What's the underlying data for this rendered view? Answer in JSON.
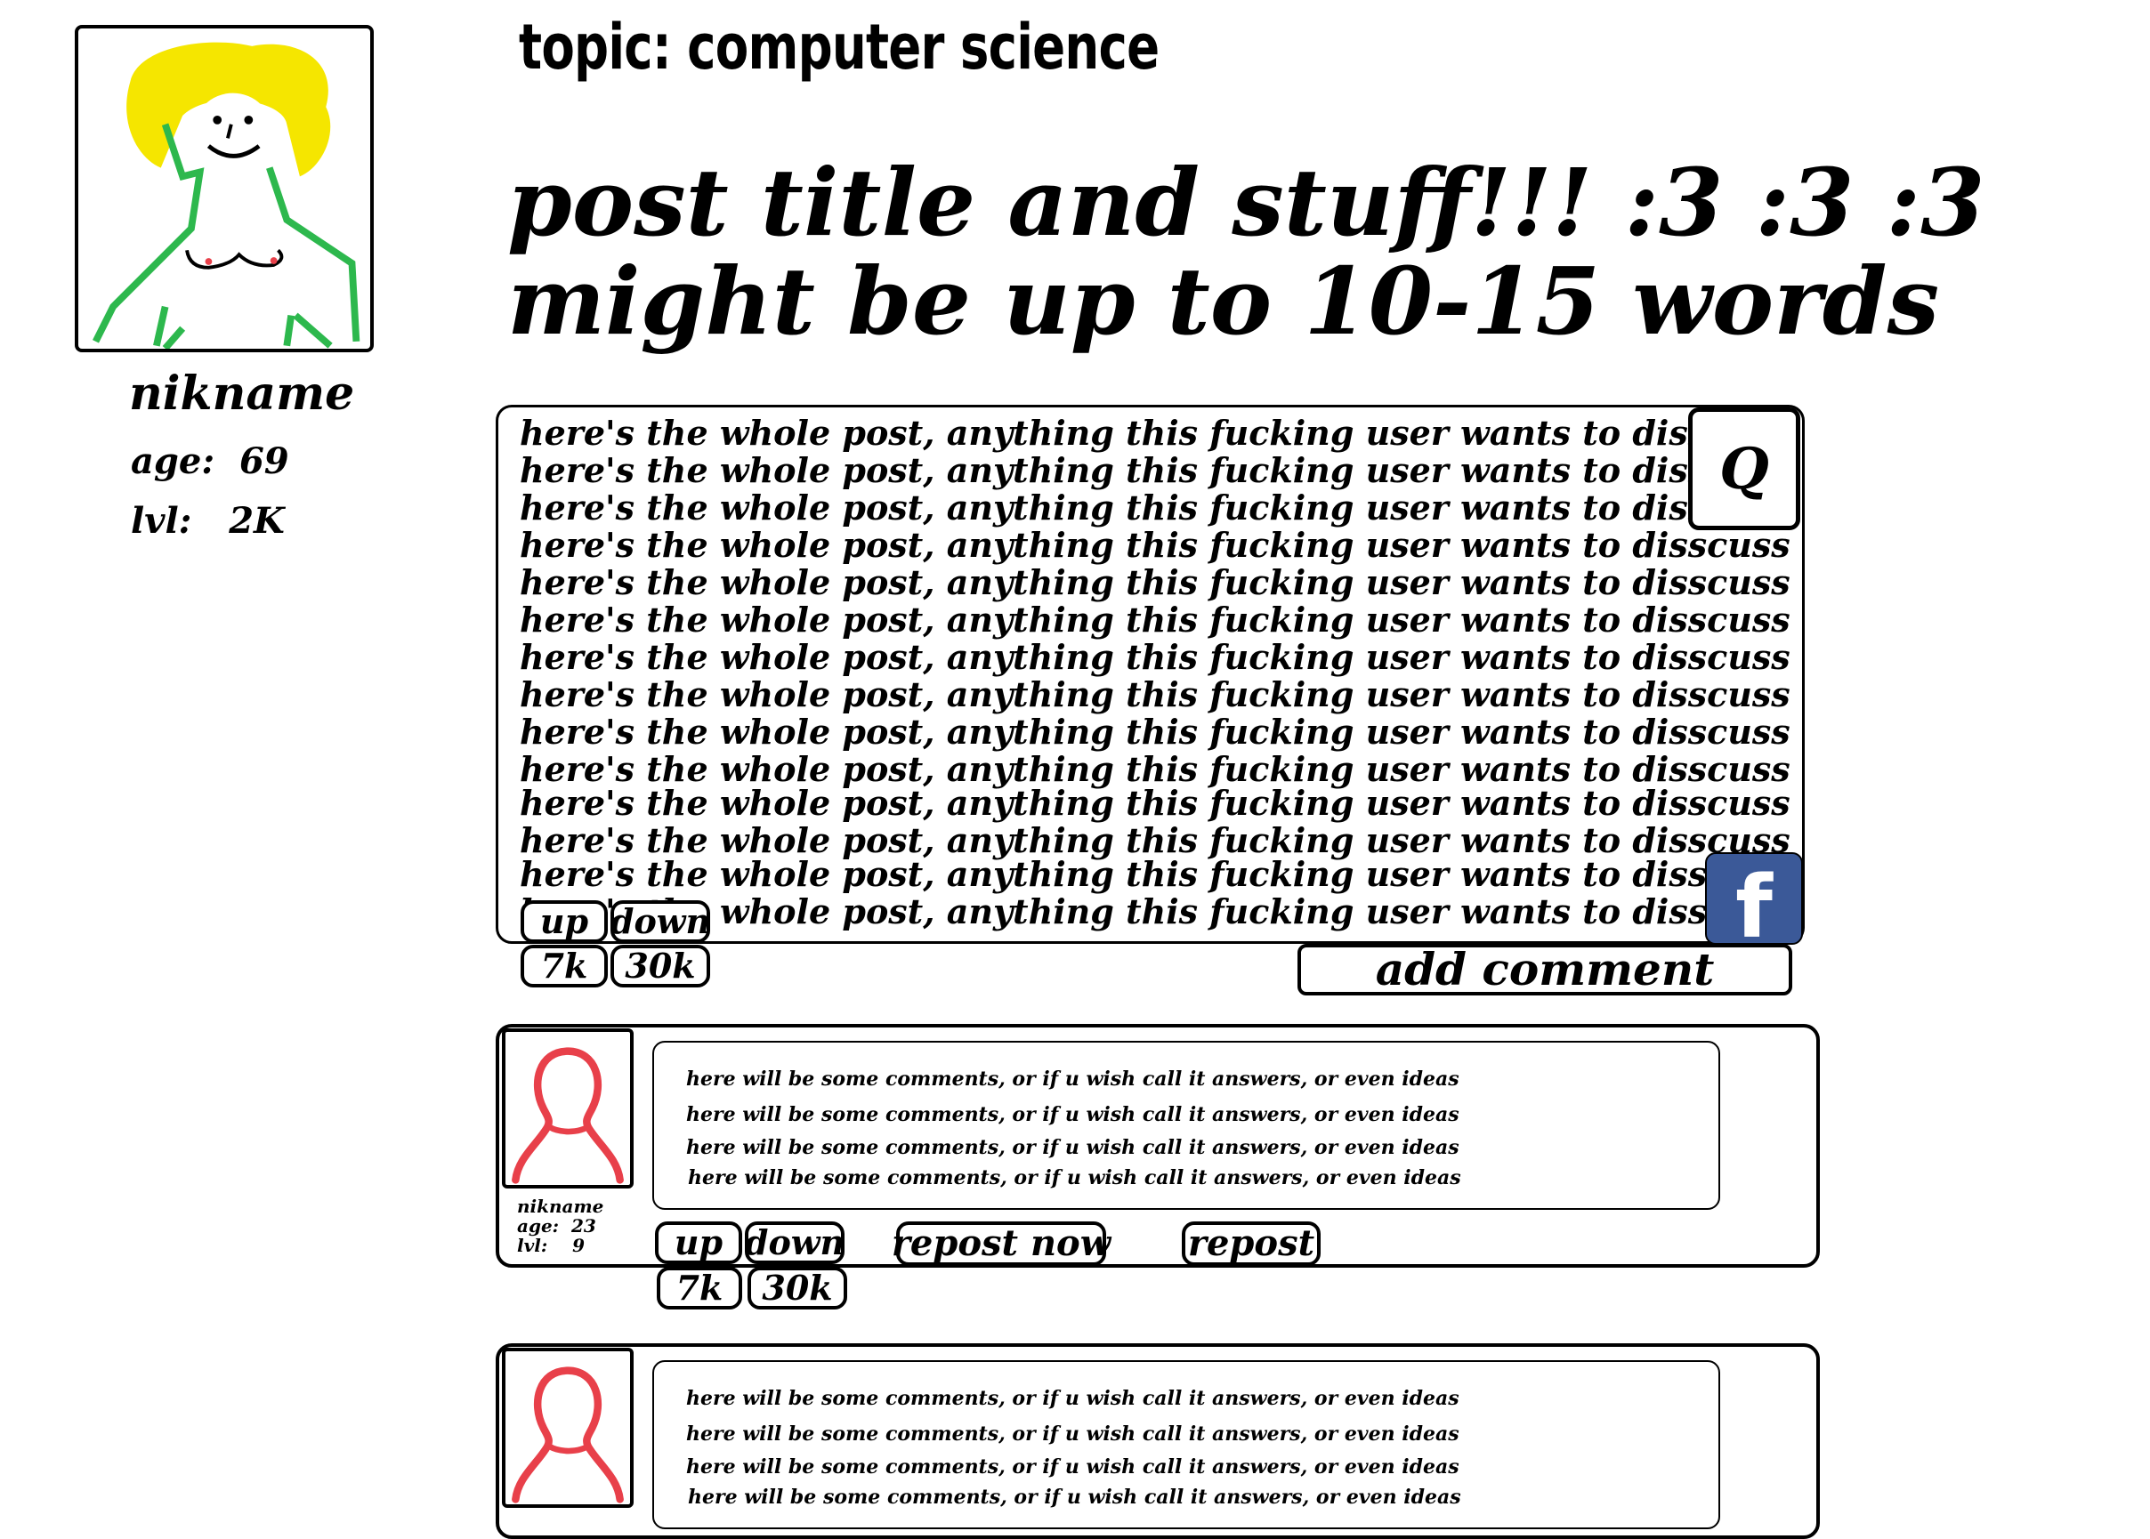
{
  "profile": {
    "name": "nikname",
    "age_label": "age:",
    "age_value": "69",
    "lvl_label": "lvl:",
    "lvl_value": "2K"
  },
  "topic": "topic: computer science",
  "post": {
    "title_lines": [
      "post title and stuff!!! :3 :3 :3",
      "might be up to 10-15 words"
    ],
    "body_line": "here's the whole post, anything this fucking user wants to disscuss an stuff...",
    "body_line_count": 14,
    "search_label": "Q",
    "facebook_label": "f",
    "up_label": "up",
    "down_label": "down",
    "up_count": "7k",
    "down_count": "30k",
    "add_comment_label": "add comment"
  },
  "comments": [
    {
      "lines": [
        "here will be some comments, or if u wish call it answers, or even ideas",
        "here will be some comments, or if u wish call it answers, or even ideas",
        "here will be some comments, or if u wish call it answers, or even ideas",
        "here will be some comments, or if u wish call it answers, or even ideas"
      ],
      "user": {
        "name": "nikname",
        "age_label": "age:",
        "age_value": "23",
        "lvl_label": "lvl:",
        "lvl_value": "9"
      },
      "up_label": "up",
      "down_label": "down",
      "up_count": "7k",
      "down_count": "30k",
      "repost_now_label": "repost now",
      "repost_label": "repost"
    },
    {
      "lines": [
        "here will be some comments, or if u wish call it answers, or even ideas",
        "here will be some comments, or if u wish call it answers, or even ideas",
        "here will be some comments, or if u wish call it answers, or even ideas",
        "here will be some comments, or if u wish call it answers, or even ideas"
      ]
    }
  ],
  "colors": {
    "hair": "#f5e600",
    "body_outline": "#2db84d",
    "comment_avatar": "#e8404a",
    "facebook": "#3b5998"
  }
}
